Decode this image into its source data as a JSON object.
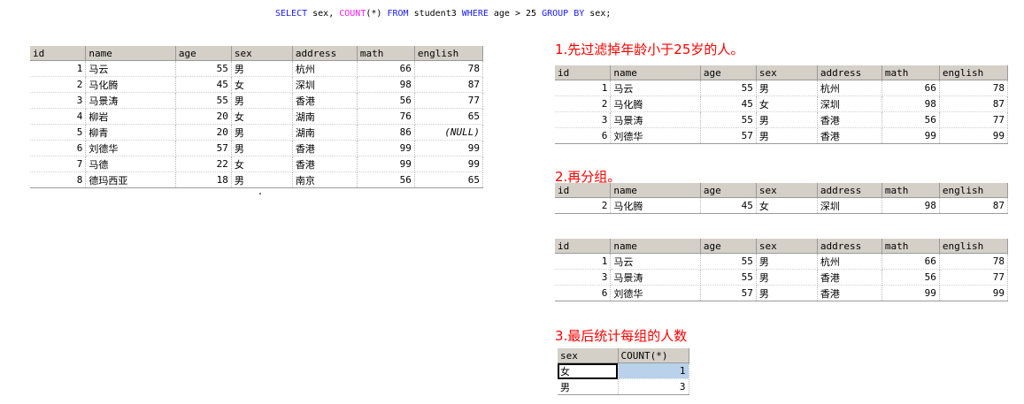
{
  "sql": {
    "p1": "SELECT",
    "p2": " sex, ",
    "p3": "COUNT",
    "p4": "(*) ",
    "p5": "FROM",
    "p6": " student3 ",
    "p7": "WHERE",
    "p8": " age > 25 ",
    "p9": "GROUP BY",
    "p10": " sex;"
  },
  "columns": [
    "id",
    "name",
    "age",
    "sex",
    "address",
    "math",
    "english"
  ],
  "main_table": [
    [
      "1",
      "马云",
      "55",
      "男",
      "杭州",
      "66",
      "78"
    ],
    [
      "2",
      "马化腾",
      "45",
      "女",
      "深圳",
      "98",
      "87"
    ],
    [
      "3",
      "马景涛",
      "55",
      "男",
      "香港",
      "56",
      "77"
    ],
    [
      "4",
      "柳岩",
      "20",
      "女",
      "湖南",
      "76",
      "65"
    ],
    [
      "5",
      "柳青",
      "20",
      "男",
      "湖南",
      "86",
      "(NULL)"
    ],
    [
      "6",
      "刘德华",
      "57",
      "男",
      "香港",
      "99",
      "99"
    ],
    [
      "7",
      "马德",
      "22",
      "女",
      "香港",
      "99",
      "99"
    ],
    [
      "8",
      "德玛西亚",
      "18",
      "男",
      "南京",
      "56",
      "65"
    ]
  ],
  "step1": {
    "title": "1.先过滤掉年龄小于25岁的人。",
    "rows": [
      [
        "1",
        "马云",
        "55",
        "男",
        "杭州",
        "66",
        "78"
      ],
      [
        "2",
        "马化腾",
        "45",
        "女",
        "深圳",
        "98",
        "87"
      ],
      [
        "3",
        "马景涛",
        "55",
        "男",
        "香港",
        "56",
        "77"
      ],
      [
        "6",
        "刘德华",
        "57",
        "男",
        "香港",
        "99",
        "99"
      ]
    ]
  },
  "step2": {
    "title": "2.再分组。",
    "group_female": [
      [
        "2",
        "马化腾",
        "45",
        "女",
        "深圳",
        "98",
        "87"
      ]
    ],
    "group_male": [
      [
        "1",
        "马云",
        "55",
        "男",
        "杭州",
        "66",
        "78"
      ],
      [
        "3",
        "马景涛",
        "55",
        "男",
        "香港",
        "56",
        "77"
      ],
      [
        "6",
        "刘德华",
        "57",
        "男",
        "香港",
        "99",
        "99"
      ]
    ]
  },
  "step3": {
    "title": "3.最后统计每组的人数",
    "columns": [
      "sex",
      "COUNT(*)"
    ],
    "rows": [
      [
        "女",
        "1"
      ],
      [
        "男",
        "3"
      ]
    ]
  }
}
